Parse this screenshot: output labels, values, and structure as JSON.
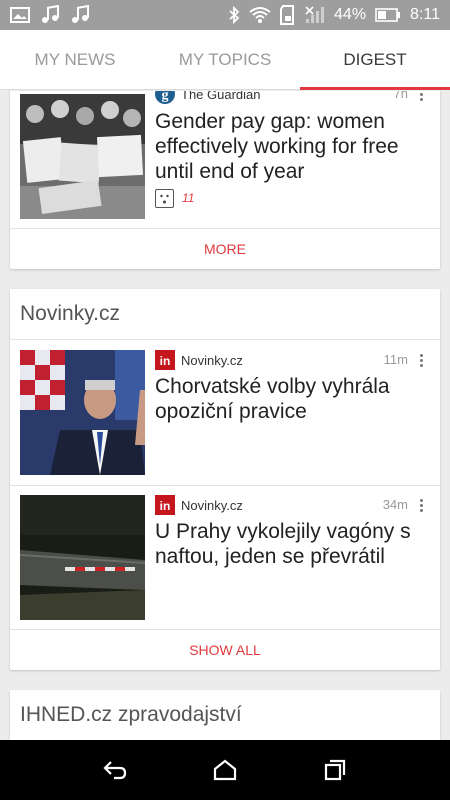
{
  "status_bar": {
    "battery_percent": "44%",
    "time": "8:11",
    "icons": [
      "gallery-icon",
      "music-note-icon",
      "music-note-icon",
      "bluetooth-icon",
      "wifi-icon",
      "sd-card-icon",
      "signal-icon",
      "battery-icon"
    ]
  },
  "tabs": [
    {
      "label": "MY NEWS",
      "active": false
    },
    {
      "label": "MY TOPICS",
      "active": false
    },
    {
      "label": "DIGEST",
      "active": true
    }
  ],
  "top_card": {
    "article": {
      "source": "The Guardian",
      "age": "7h",
      "headline": "Gender pay gap: women effectively working for free until end of year",
      "reaction_count": "11"
    },
    "more_label": "MORE"
  },
  "novinky_card": {
    "title": "Novinky.cz",
    "articles": [
      {
        "source": "Novinky.cz",
        "age": "11m",
        "headline": "Chorvatské volby vyhrála opoziční pravice"
      },
      {
        "source": "Novinky.cz",
        "age": "34m",
        "headline": "U Prahy vykolejily vagóny s naftou, jeden se převrátil"
      }
    ],
    "show_all_label": "SHOW ALL"
  },
  "ihned_card": {
    "title": "IHNED.cz zpravodajství"
  },
  "colors": {
    "accent": "#e03a3e",
    "status_bar": "#9e9e9e",
    "nav_bar": "#000000"
  }
}
